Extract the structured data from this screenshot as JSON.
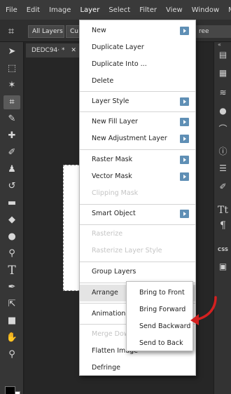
{
  "menubar": {
    "items": [
      "File",
      "Edit",
      "Image",
      "Layer",
      "Select",
      "Filter",
      "View",
      "Window",
      "M"
    ],
    "active_index": 3
  },
  "optionsbar": {
    "layers_button": "All Layers",
    "second_button": "Cu",
    "right_text": "ree",
    "tool_icon": "crop-icon"
  },
  "document": {
    "tab_title": "DEDC94⋅ *",
    "tab_close": "✕",
    "canvas_color": "#ffffff"
  },
  "toolbar": {
    "icons": [
      "move-icon",
      "marquee-icon",
      "lasso-icon",
      "crop-icon",
      "eyedropper-icon",
      "healing-icon",
      "brush-icon",
      "stamp-icon",
      "history-brush-icon",
      "eraser-icon",
      "gradient-icon",
      "blur-icon",
      "dodge-icon",
      "type-icon",
      "pen-icon",
      "path-select-icon",
      "shape-icon",
      "hand-icon",
      "zoom-icon"
    ],
    "selected": "crop-icon"
  },
  "rightpanel": {
    "icons": [
      "history-icon",
      "layers-icon",
      "layer-stack-icon",
      "color-icon",
      "curves-icon",
      "info-icon",
      "adjust-icon",
      "brushes-icon",
      "character-icon",
      "paragraph-icon",
      "css-icon",
      "image-icon"
    ],
    "css_label": "CSS"
  },
  "menu": {
    "items": [
      {
        "label": "New",
        "submenu": true,
        "disabled": false
      },
      {
        "label": "Duplicate Layer",
        "submenu": false,
        "disabled": false
      },
      {
        "label": "Duplicate Into ...",
        "submenu": false,
        "disabled": false
      },
      {
        "label": "Delete",
        "submenu": false,
        "disabled": false
      },
      {
        "label": "Layer Style",
        "submenu": true,
        "disabled": false
      },
      {
        "label": "New Fill Layer",
        "submenu": true,
        "disabled": false
      },
      {
        "label": "New Adjustment Layer",
        "submenu": true,
        "disabled": false
      },
      {
        "label": "Raster Mask",
        "submenu": true,
        "disabled": false
      },
      {
        "label": "Vector Mask",
        "submenu": true,
        "disabled": false
      },
      {
        "label": "Clipping Mask",
        "submenu": false,
        "disabled": true
      },
      {
        "label": "Smart Object",
        "submenu": true,
        "disabled": false
      },
      {
        "label": "Rasterize",
        "submenu": false,
        "disabled": true
      },
      {
        "label": "Rasterize Layer Style",
        "submenu": false,
        "disabled": true
      },
      {
        "label": "Group Layers",
        "submenu": false,
        "disabled": false
      },
      {
        "label": "Arrange",
        "submenu": false,
        "disabled": false,
        "highlighted": true
      },
      {
        "label": "Animation",
        "submenu": false,
        "disabled": false
      },
      {
        "label": "Merge Dow",
        "submenu": false,
        "disabled": true
      },
      {
        "label": "Flatten Image",
        "submenu": false,
        "disabled": false
      },
      {
        "label": "Defringe",
        "submenu": false,
        "disabled": false
      }
    ]
  },
  "submenu": {
    "items": [
      "Bring to Front",
      "Bring Forward",
      "Send Backward",
      "Send to Back"
    ]
  },
  "annotation": {
    "arrow_color": "#d42020"
  }
}
